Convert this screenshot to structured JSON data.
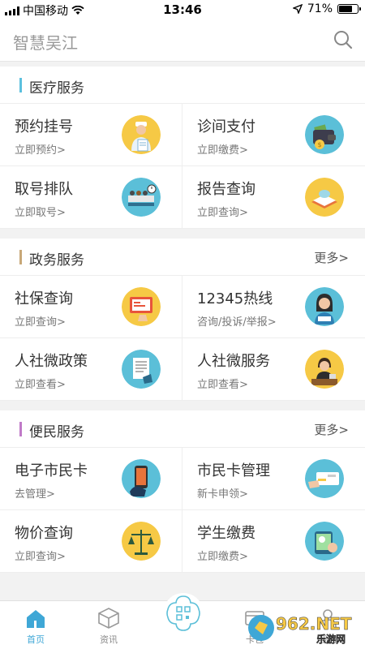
{
  "status_bar": {
    "carrier": "中国移动",
    "time": "13:46",
    "battery": "71%",
    "battery_level": 0.71
  },
  "header": {
    "title": "智慧吴江"
  },
  "sections": [
    {
      "title": "医疗服务",
      "more": "",
      "accent": "#5bc0de",
      "items": [
        {
          "title": "预约挂号",
          "sub": "立即预约>",
          "icon": "doctor-icon"
        },
        {
          "title": "诊间支付",
          "sub": "立即缴费>",
          "icon": "wallet-icon"
        },
        {
          "title": "取号排队",
          "sub": "立即取号>",
          "icon": "queue-icon"
        },
        {
          "title": "报告查询",
          "sub": "立即查询>",
          "icon": "report-icon"
        }
      ]
    },
    {
      "title": "政务服务",
      "more": "更多>",
      "accent": "#c8a878",
      "items": [
        {
          "title": "社保查询",
          "sub": "立即查询>",
          "icon": "social-security-icon"
        },
        {
          "title": "12345热线",
          "sub": "咨询/投诉/举报>",
          "icon": "hotline-icon"
        },
        {
          "title": "人社微政策",
          "sub": "立即查看>",
          "icon": "policy-icon"
        },
        {
          "title": "人社微服务",
          "sub": "立即查看>",
          "icon": "service-icon"
        }
      ]
    },
    {
      "title": "便民服务",
      "more": "更多>",
      "accent": "#c07ac8",
      "items": [
        {
          "title": "电子市民卡",
          "sub": "去管理>",
          "icon": "phone-card-icon"
        },
        {
          "title": "市民卡管理",
          "sub": "新卡申领>",
          "icon": "card-manage-icon"
        },
        {
          "title": "物价查询",
          "sub": "立即查询>",
          "icon": "scale-icon"
        },
        {
          "title": "学生缴费",
          "sub": "立即缴费>",
          "icon": "student-pay-icon"
        }
      ]
    }
  ],
  "tabs": [
    {
      "label": "首页",
      "icon": "home-icon",
      "active": true
    },
    {
      "label": "资讯",
      "icon": "cube-icon",
      "active": false
    },
    {
      "label": "",
      "icon": "qr-scan-icon",
      "active": false
    },
    {
      "label": "卡包",
      "icon": "card-icon",
      "active": false
    },
    {
      "label": "我的",
      "icon": "user-icon",
      "active": false
    }
  ],
  "watermark": {
    "brand": "962.NET",
    "sub": "乐游网"
  },
  "colors": {
    "accent_blue": "#3fa7d6",
    "icon_yellow": "#f6c945",
    "icon_blue": "#5bbfd8"
  }
}
